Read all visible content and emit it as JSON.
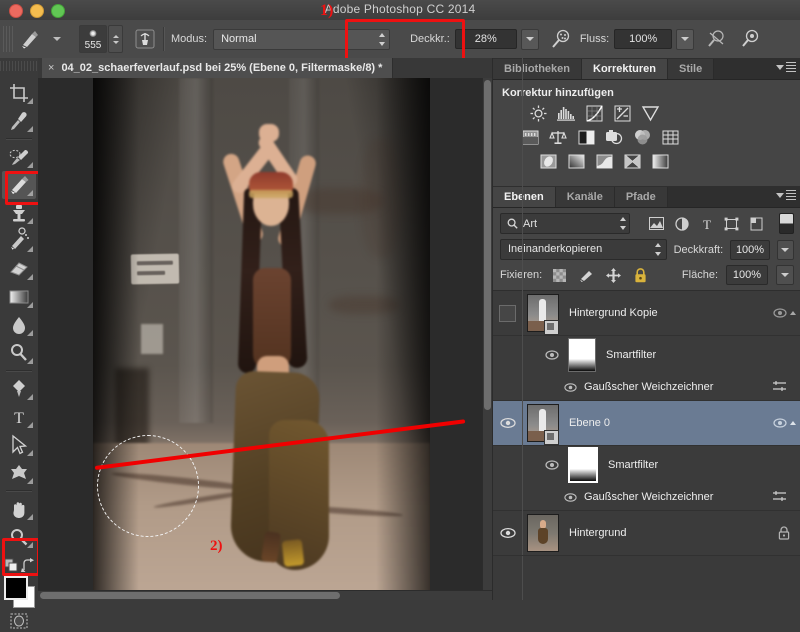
{
  "window": {
    "title": "Adobe Photoshop CC 2014",
    "traffic_lights": [
      "close",
      "minimize",
      "zoom"
    ]
  },
  "options_bar": {
    "brush_preview_size": "555",
    "mode_label": "Modus:",
    "mode_value": "Normal",
    "opacity_label": "Deckkr.:",
    "opacity_value": "28%",
    "flow_label": "Fluss:",
    "flow_value": "100%",
    "icons": [
      "brush-preset-icon",
      "brush-panel-icon",
      "airbrush-icon",
      "pressure-opacity-icon",
      "pressure-size-icon"
    ]
  },
  "annotations": {
    "marker1": "1)",
    "marker2": "2)",
    "highlight_color": "#ee1111"
  },
  "document_tab": {
    "close": "×",
    "label": "04_02_schaerfeverlauf.psd bei 25% (Ebene 0, Filtermaske/8) *"
  },
  "tools": [
    {
      "name": "crop-tool",
      "glyph": "crop"
    },
    {
      "name": "eyedropper-tool",
      "glyph": "eyedropper"
    },
    {
      "name": "spot-healing-brush-tool",
      "glyph": "healing"
    },
    {
      "name": "brush-tool",
      "glyph": "brush",
      "selected": true
    },
    {
      "name": "clone-stamp-tool",
      "glyph": "stamp"
    },
    {
      "name": "history-brush-tool",
      "glyph": "history-brush"
    },
    {
      "name": "eraser-tool",
      "glyph": "eraser"
    },
    {
      "name": "gradient-tool",
      "glyph": "gradient"
    },
    {
      "name": "blur-tool",
      "glyph": "blur"
    },
    {
      "name": "dodge-tool",
      "glyph": "dodge"
    },
    {
      "name": "pen-tool",
      "glyph": "pen"
    },
    {
      "name": "type-tool",
      "glyph": "T"
    },
    {
      "name": "path-selection-tool",
      "glyph": "arrow"
    },
    {
      "name": "custom-shape-tool",
      "glyph": "shape"
    },
    {
      "name": "hand-tool",
      "glyph": "hand"
    },
    {
      "name": "zoom-tool",
      "glyph": "magnifier"
    }
  ],
  "color_swatches": {
    "foreground": "#000000",
    "background": "#ffffff"
  },
  "adjustments_panel": {
    "tabs": [
      {
        "label": "Bibliotheken",
        "active": false
      },
      {
        "label": "Korrekturen",
        "active": true
      },
      {
        "label": "Stile",
        "active": false
      }
    ],
    "title": "Korrektur hinzufügen",
    "rows": [
      [
        "brightness-contrast-icon",
        "levels-icon",
        "curves-icon",
        "exposure-icon",
        "vibrance-icon"
      ],
      [
        "hue-saturation-icon",
        "color-balance-icon",
        "black-white-icon",
        "photo-filter-icon",
        "channel-mixer-icon",
        "color-lookup-icon"
      ],
      [
        "invert-icon",
        "posterize-icon",
        "threshold-icon",
        "selective-color-icon",
        "gradient-map-icon"
      ]
    ]
  },
  "layers_panel": {
    "tabs": [
      {
        "label": "Ebenen",
        "active": true
      },
      {
        "label": "Kanäle",
        "active": false
      },
      {
        "label": "Pfade",
        "active": false
      }
    ],
    "filter_value": "Art",
    "filter_icons": [
      "pixel-filter-icon",
      "adjustment-filter-icon",
      "type-filter-icon",
      "shape-filter-icon",
      "smartobject-filter-icon"
    ],
    "blend_mode": "Ineinanderkopieren",
    "opacity_label": "Deckkraft:",
    "opacity_value": "100%",
    "lock_label": "Fixieren:",
    "lock_icons": [
      "lock-transparent-pixels-icon",
      "lock-image-pixels-icon",
      "lock-position-icon",
      "lock-all-icon"
    ],
    "fill_label": "Fläche:",
    "fill_value": "100%",
    "layers": [
      {
        "name": "Hintergrund Kopie",
        "visible": false,
        "selected": false,
        "smart_object": true,
        "smart_filters": {
          "label": "Smartfilter",
          "mask_visible": true,
          "mask_selected": false,
          "filters": [
            {
              "name": "Gaußscher Weichzeichner",
              "visible": true
            }
          ]
        }
      },
      {
        "name": "Ebene 0",
        "visible": true,
        "selected": true,
        "smart_object": true,
        "smart_filters": {
          "label": "Smartfilter",
          "mask_visible": true,
          "mask_selected": true,
          "filters": [
            {
              "name": "Gaußscher Weichzeichner",
              "visible": true
            }
          ]
        }
      },
      {
        "name": "Hintergrund",
        "visible": true,
        "selected": false,
        "locked": true,
        "smart_object": false
      }
    ]
  }
}
